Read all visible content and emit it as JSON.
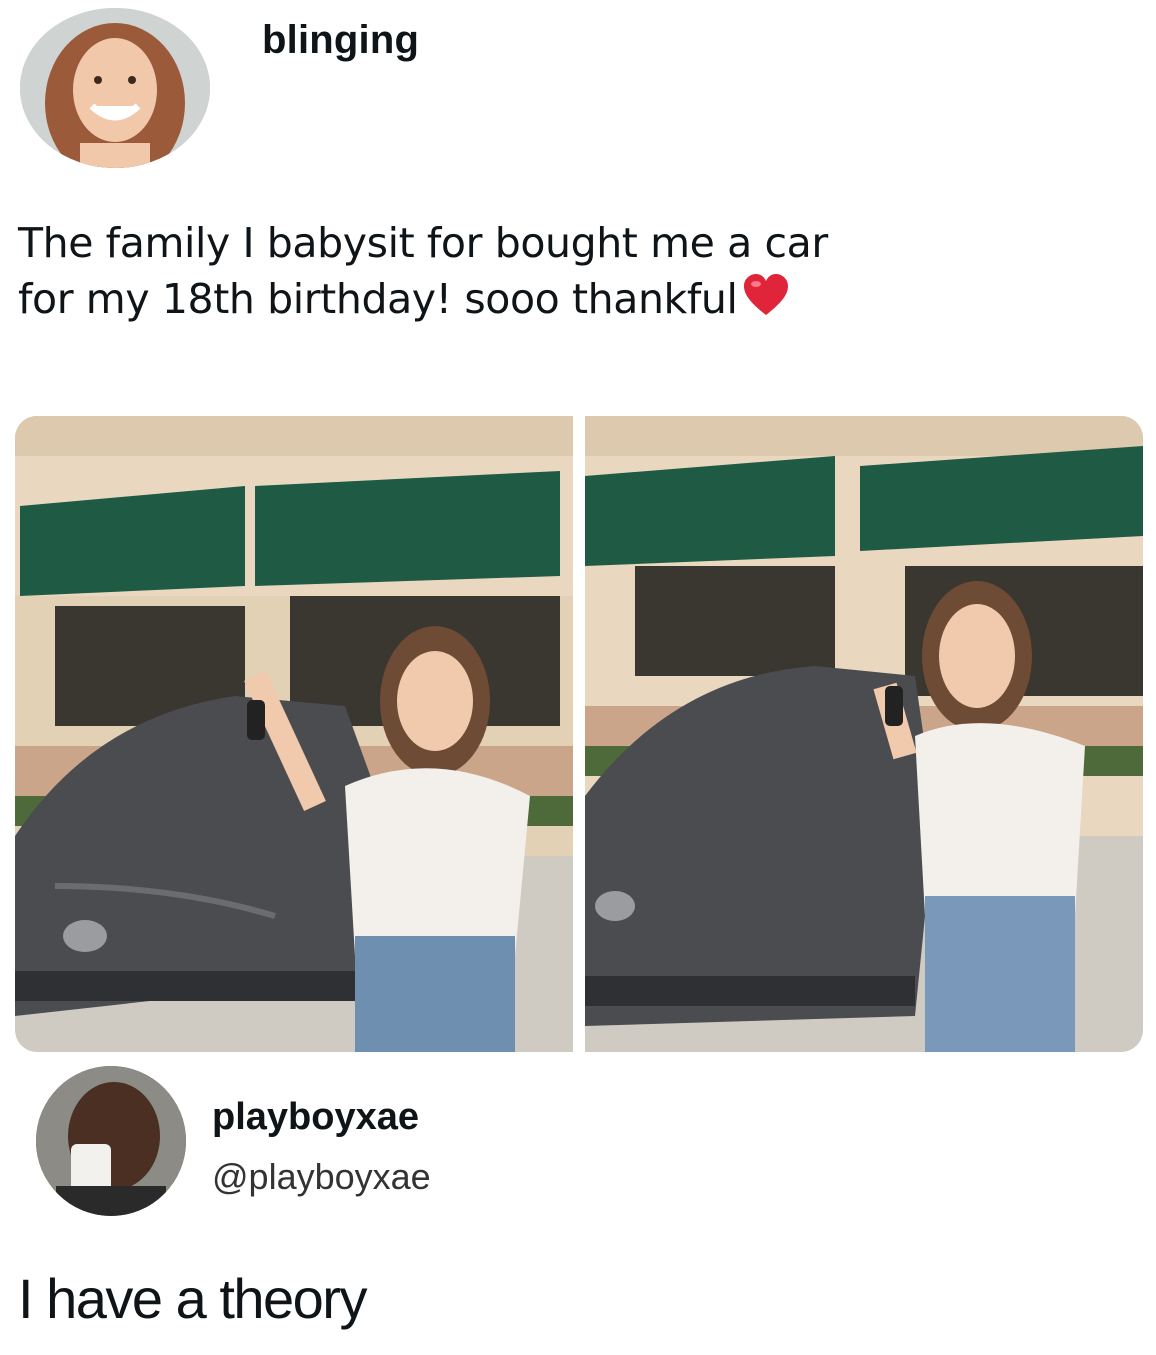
{
  "post": {
    "username": "blinging",
    "text_line1": "The family I babysit for bought me a car",
    "text_line2": "for my 18th birthday! sooo thankful",
    "emoji": "heart-emoji",
    "photos": [
      "photo-girl-with-car-left",
      "photo-girl-with-car-right"
    ]
  },
  "reply": {
    "display_name": "playboyxae",
    "handle": "@playboyxae",
    "text": "I have a theory"
  },
  "colors": {
    "awning": "#1f5a45",
    "wall": "#e9d8bf",
    "car": "#4a4c50",
    "heart": "#e0243a"
  }
}
